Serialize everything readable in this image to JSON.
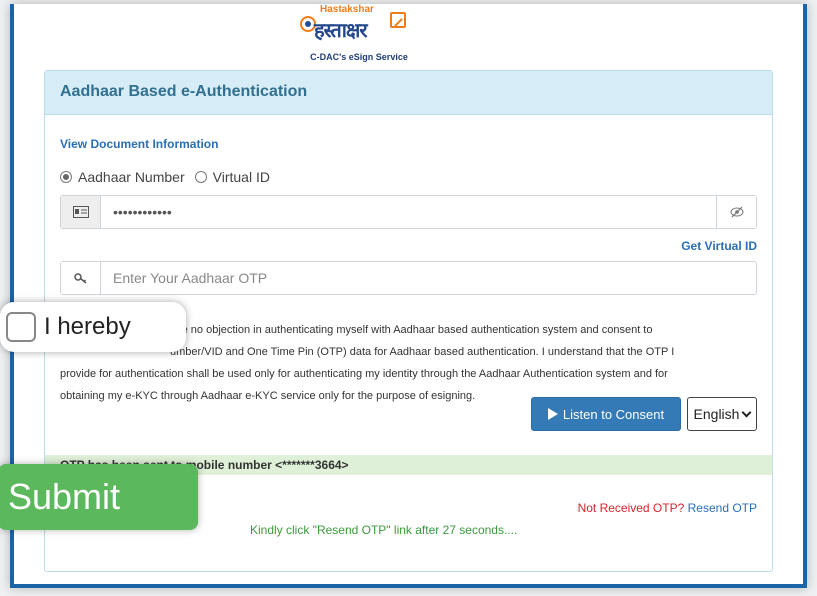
{
  "logo": {
    "brand_top": "Hastakshar",
    "brand_devanagari": "हस्ताक्षर",
    "tagline": "C-DAC's eSign Service"
  },
  "panel": {
    "title": "Aadhaar Based e-Authentication",
    "view_document": "View Document Information"
  },
  "auth_mode": {
    "options": [
      {
        "label": "Aadhaar Number",
        "selected": true
      },
      {
        "label": "Virtual ID",
        "selected": false
      }
    ]
  },
  "aadhaar_input": {
    "value": "••••••••••••",
    "addon_icon": "id-card-icon",
    "toggle_icon": "eye-slash-icon"
  },
  "get_virtual_id": "Get Virtual ID",
  "otp_input": {
    "placeholder": "Enter Your Aadhaar OTP",
    "value": "",
    "addon_icon": "key-icon"
  },
  "consent": {
    "line1": "ave no objection in authenticating myself with Aadhaar based authentication system and consent to",
    "line2": "umber/VID and One Time Pin (OTP) data for Aadhaar based authentication. I understand that the OTP I",
    "line3": "provide for authentication shall be used only for authenticating my identity through the Aadhaar Authentication system and for",
    "line4": "obtaining my e-KYC through Aadhaar e-KYC service only for the purpose of esigning.",
    "callout_text": "I hereby",
    "checked": false
  },
  "listen_button": "Listen to Consent",
  "language": {
    "selected": "English"
  },
  "otp_status": "OTP has been sent to mobile number <*******3664>",
  "submit_label": "Submit",
  "resend": {
    "not_received": "Not Received OTP?",
    "link": "Resend OTP",
    "message": "Kindly click \"Resend OTP\" link after 27 seconds...."
  },
  "colors": {
    "frame_border": "#1b64a8",
    "panel_header_bg": "#d6ecf7",
    "primary_button": "#337ab7",
    "success_bg": "#dff0d8",
    "submit_button": "#5cb85c",
    "error_text": "#d9232d"
  }
}
